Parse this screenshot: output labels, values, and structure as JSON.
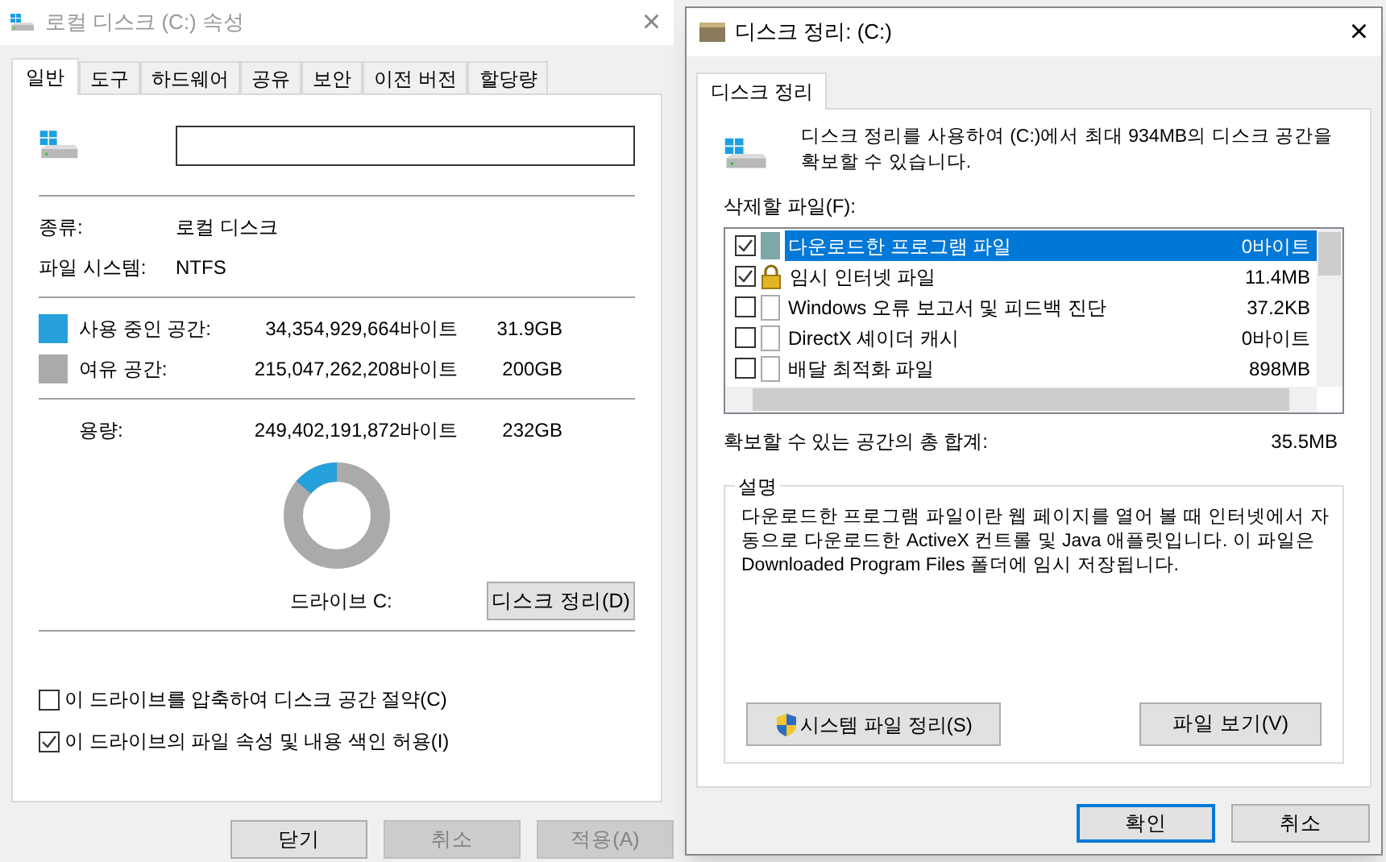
{
  "properties_window": {
    "title": "로컬 디스크 (C:) 속성",
    "close": "×",
    "tabs": [
      {
        "label": "일반",
        "selected": true
      },
      {
        "label": "도구",
        "selected": false
      },
      {
        "label": "하드웨어",
        "selected": false
      },
      {
        "label": "공유",
        "selected": false
      },
      {
        "label": "보안",
        "selected": false
      },
      {
        "label": "이전 버전",
        "selected": false
      },
      {
        "label": "할당량",
        "selected": false
      }
    ],
    "info": [
      {
        "label": "종류:",
        "value": "로컬 디스크"
      },
      {
        "label": "파일 시스템:",
        "value": "NTFS"
      }
    ],
    "space": [
      {
        "label": "사용 중인 공간:",
        "bytes": "34,354,929,664바이트",
        "size": "31.9GB",
        "color": "#26a0da"
      },
      {
        "label": "여유 공간:",
        "bytes": "215,047,262,208바이트",
        "size": "200GB",
        "color": "#aaaaaa"
      }
    ],
    "capacity": {
      "label": "용량:",
      "bytes": "249,402,191,872바이트",
      "size": "232GB"
    },
    "drive_chart": {
      "level": 0.138,
      "caption": "드라이브 C:"
    },
    "cleanup_button": "디스크 정리(D)",
    "options": [
      {
        "label": "이 드라이브를 압축하여 디스크 공간 절약(C)",
        "checked": false
      },
      {
        "label": "이 드라이브의 파일 속성 및 내용 색인 허용(I)",
        "checked": true
      }
    ],
    "buttons": [
      {
        "label": "닫기",
        "disabled": false
      },
      {
        "label": "취소",
        "disabled": true
      },
      {
        "label": "적용(A)",
        "disabled": true
      }
    ]
  },
  "cleanup_window": {
    "title": "디스크 정리: (C:)",
    "close": "×",
    "tabs": [
      {
        "label": "디스크 정리",
        "selected": true
      }
    ],
    "intro": "디스크 정리를 사용하여 (C:)에서 최대 934MB의 디스크 공간을 확보할 수 있습니다.",
    "files_label": "삭제할 파일(F):",
    "files": [
      {
        "name": "다운로드한 프로그램 파일",
        "size": "0바이트",
        "checked": true,
        "selected": true,
        "kind": "folder"
      },
      {
        "name": "임시 인터넷 파일",
        "size": "11.4MB",
        "checked": true,
        "selected": false,
        "kind": "lock"
      },
      {
        "name": "Windows 오류 보고서 및 피드백 진단",
        "size": "37.2KB",
        "checked": false,
        "selected": false,
        "kind": "file"
      },
      {
        "name": "DirectX 셰이더 캐시",
        "size": "0바이트",
        "checked": false,
        "selected": false,
        "kind": "file"
      },
      {
        "name": "배달 최적화 파일",
        "size": "898MB",
        "checked": false,
        "selected": false,
        "kind": "file"
      }
    ],
    "total_label": "확보할 수 있는 공간의 총 합계:",
    "total": "35.5MB",
    "description_title": "설명",
    "description": "다운로드한 프로그램 파일이란 웹 페이지를 열어 볼 때 인터넷에서 자동으로 다운로드한 ActiveX 컨트롤 및 Java 애플릿입니다. 이 파일은 Downloaded Program Files 폴더에 임시 저장됩니다.",
    "system_button": "시스템 파일 정리(S)",
    "view_button": "파일 보기(V)",
    "buttons": [
      {
        "label": "확인",
        "selected": true
      },
      {
        "label": "취소",
        "selected": false
      }
    ]
  }
}
